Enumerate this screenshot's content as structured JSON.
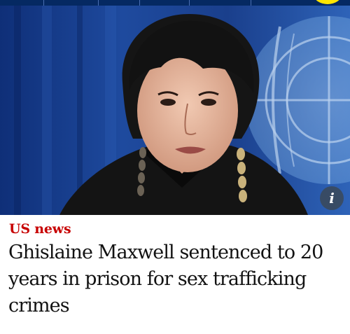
{
  "header": {
    "brand_color": "#052962",
    "badge_color": "#ffe500"
  },
  "article": {
    "image_description_icon": "info-icon",
    "image_info_glyph": "i",
    "kicker": "US news",
    "kicker_color": "#c70000",
    "headline": "Ghislaine Maxwell sentenced to 20 years in prison for sex trafficking crimes"
  }
}
